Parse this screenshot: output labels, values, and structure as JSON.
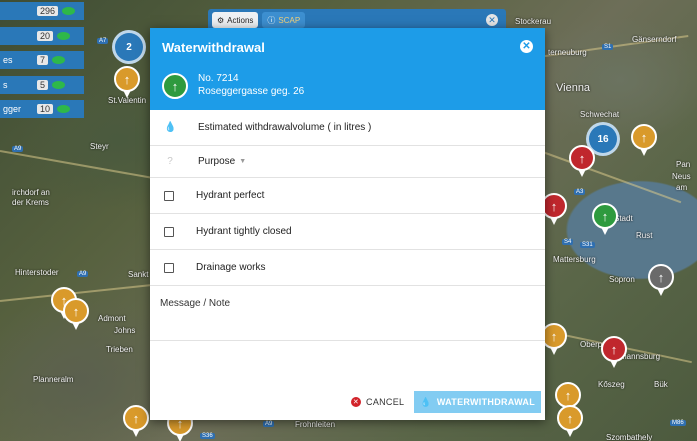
{
  "map": {
    "labels": [
      "Stockerau",
      "Gänserndorf",
      "terneuburg",
      "Vienna",
      "Schwechat",
      "Pan",
      "Neus",
      "am",
      "Steyr",
      "irchdorf an",
      "der Krems",
      "Rust",
      "Mattersburg",
      "Sopron",
      "Hinterstoder",
      "Sankt",
      "Admont",
      "Johns",
      "Trieben",
      "Planneralm",
      "Oberp",
      "mannsburg",
      "Kőszeg",
      "Bük",
      "Szombathely",
      "Frohnleiten",
      "St.Valentin",
      "Stadt"
    ],
    "cluster_counts": [
      "2",
      "16"
    ]
  },
  "counters": [
    {
      "label": "",
      "value": "296"
    },
    {
      "label": "",
      "value": "20"
    },
    {
      "label": "es",
      "value": "7"
    },
    {
      "label": "s",
      "value": "5"
    },
    {
      "label": "gger",
      "value": "10"
    }
  ],
  "toolbar": {
    "actions_label": "Actions",
    "scap_label": "SCAP",
    "gear_icon": "gear-icon",
    "info_icon": "info-icon",
    "close_icon": "close-icon"
  },
  "dialog": {
    "title": "Waterwithdrawal",
    "hydrant_no": "No. 7214",
    "hydrant_address": "Roseggergasse geg. 26",
    "volume_placeholder": "Estimated withdrawalvolume ( in litres )",
    "purpose_label": "Purpose",
    "checkbox_hydrant_perfect": "Hydrant perfect",
    "checkbox_hydrant_closed": "Hydrant tightly closed",
    "checkbox_drainage": "Drainage works",
    "message_placeholder": "Message / Note",
    "cancel_label": "CANCEL",
    "submit_label": "WATERWITHDRAWAL"
  },
  "colors": {
    "header": "#1d9ce8",
    "toolbar": "#2a78b8",
    "submit": "#82ccf2",
    "cancel_icon": "#d2232a"
  }
}
